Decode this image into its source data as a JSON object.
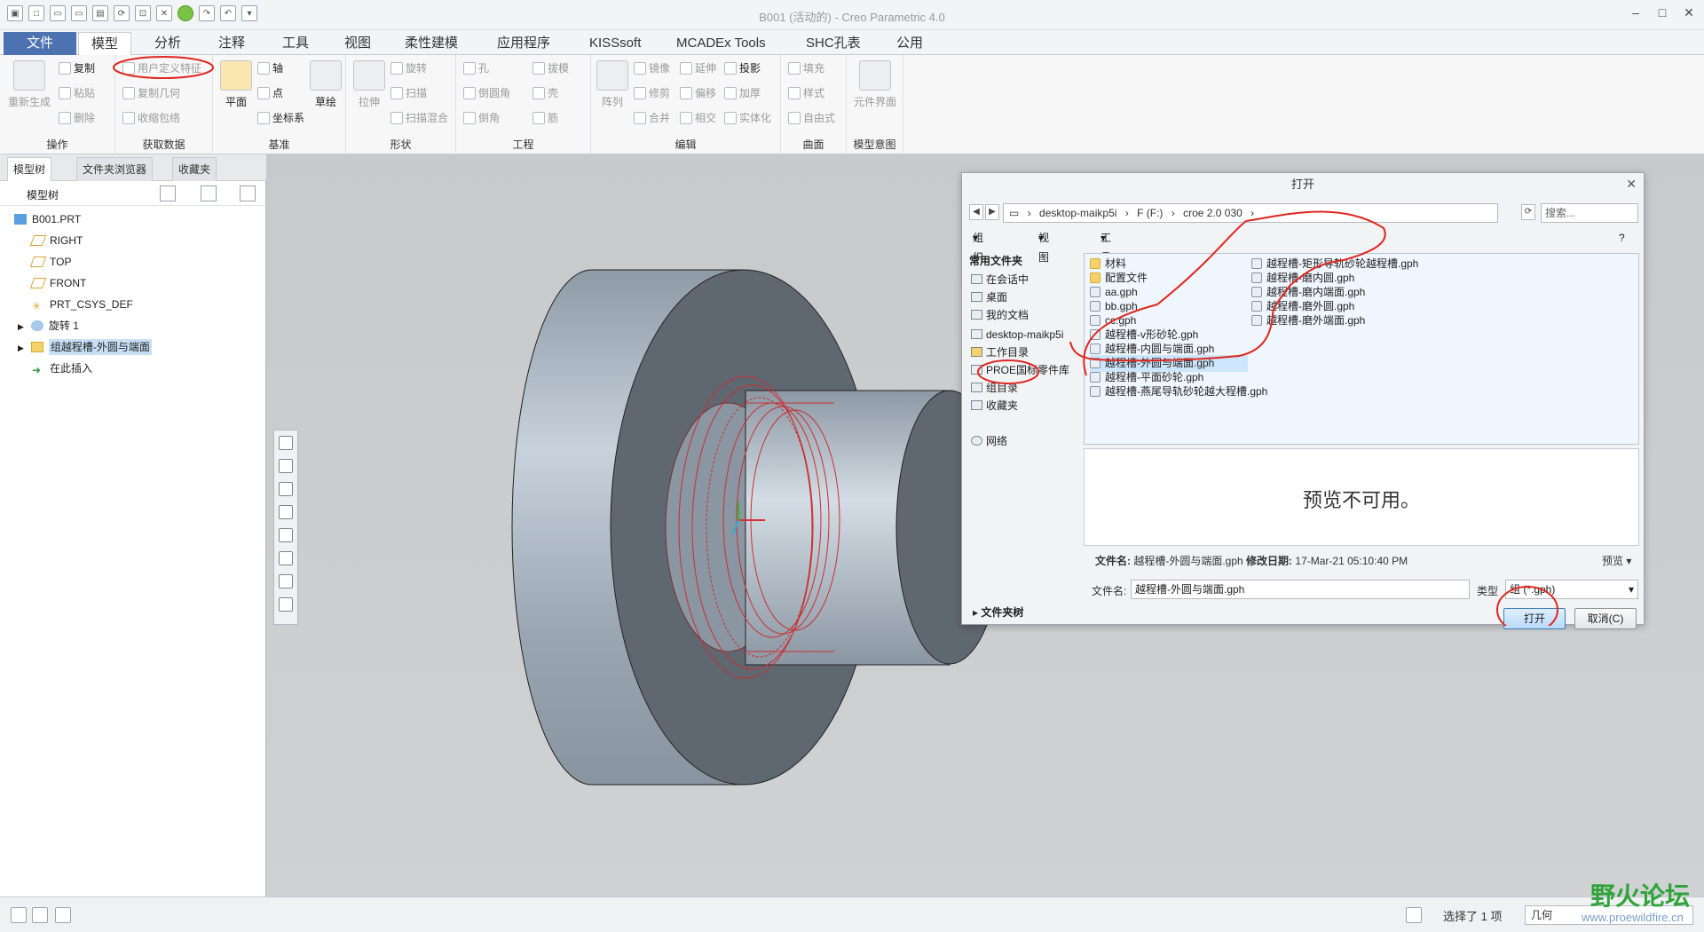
{
  "app": {
    "title": "B001 (活动的) - Creo Parametric 4.0"
  },
  "tabs": [
    "文件",
    "模型",
    "分析",
    "注释",
    "工具",
    "视图",
    "柔性建模",
    "应用程序",
    "KISSsoft",
    "MCADEx Tools",
    "SHC孔表",
    "公用"
  ],
  "active_tab": "模型",
  "ribbon": {
    "ops": {
      "label": "操作",
      "regen": "重新生成",
      "copy": "复制",
      "paste": "粘贴",
      "delete": "删除"
    },
    "getdata": {
      "label": "获取数据",
      "udf": "用户定义特征",
      "copygeom": "复制几何",
      "shrinkwrap": "收缩包络"
    },
    "datum": {
      "label": "基准",
      "plane": "平面",
      "axis": "轴",
      "point": "点",
      "csys": "坐标系",
      "sketch": "草绘"
    },
    "shape": {
      "label": "形状",
      "extrude": "拉伸",
      "revolve": "旋转",
      "sweep": "扫描",
      "sweptblend": "扫描混合"
    },
    "eng": {
      "label": "工程",
      "hole": "孔",
      "round": "倒圆角",
      "chamfer": "倒角",
      "draft": "拔模",
      "shell": "壳",
      "rib": "筋"
    },
    "edit": {
      "label": "编辑",
      "pattern": "阵列",
      "mirror": "镜像",
      "extend": "延伸",
      "project": "投影",
      "trim": "修剪",
      "offset": "偏移",
      "thicken": "加厚",
      "merge": "合并",
      "intersect": "相交",
      "solidify": "实体化"
    },
    "surfaces": {
      "label": "曲面",
      "fill": "填充",
      "style": "样式",
      "freestyle": "自由式"
    },
    "intent": {
      "label": "模型意图",
      "component_interface": "元件界面"
    }
  },
  "left_panel": {
    "tabs": [
      "模型树",
      "文件夹浏览器",
      "收藏夹"
    ],
    "tree_header": "模型树",
    "items": [
      {
        "label": "B001.PRT",
        "icon": "part-icon"
      },
      {
        "label": "RIGHT",
        "icon": "datum-plane-icon"
      },
      {
        "label": "TOP",
        "icon": "datum-plane-icon"
      },
      {
        "label": "FRONT",
        "icon": "datum-plane-icon"
      },
      {
        "label": "PRT_CSYS_DEF",
        "icon": "csys-icon"
      },
      {
        "label": "旋转 1",
        "icon": "revolve-icon"
      },
      {
        "label": "组越程槽-外圆与端面",
        "icon": "group-icon"
      },
      {
        "label": "在此插入",
        "icon": "insert-arrow-icon"
      }
    ]
  },
  "dialog": {
    "title": "打开",
    "address": [
      "desktop-maikp5i",
      "F (F:)",
      "croe 2.0 030"
    ],
    "search_placeholder": "搜索...",
    "toolbar": {
      "organize": "组织",
      "views": "视图",
      "tools": "工具"
    },
    "nav_header": "常用文件夹",
    "nav_items": [
      "在会话中",
      "桌面",
      "我的文档",
      "desktop-maikp5i",
      "工作目录",
      "PROE国标零件库",
      "组目录",
      "收藏夹",
      "网络"
    ],
    "files_col1": [
      {
        "name": "材料",
        "type": "folder"
      },
      {
        "name": "配置文件",
        "type": "folder"
      },
      {
        "name": "aa.gph",
        "type": "gph"
      },
      {
        "name": "bb.gph",
        "type": "gph"
      },
      {
        "name": "cc.gph",
        "type": "gph"
      },
      {
        "name": "越程槽-v形砂轮.gph",
        "type": "gph"
      },
      {
        "name": "越程槽-内圆与端面.gph",
        "type": "gph"
      },
      {
        "name": "越程槽-外圆与端面.gph",
        "type": "gph"
      },
      {
        "name": "越程槽-平面砂轮.gph",
        "type": "gph"
      },
      {
        "name": "越程槽-燕尾导轨砂轮越大程槽.gph",
        "type": "gph"
      }
    ],
    "files_col2": [
      {
        "name": "越程槽-矩形导轨砂轮越程槽.gph",
        "type": "gph"
      },
      {
        "name": "越程槽-磨内圆.gph",
        "type": "gph"
      },
      {
        "name": "越程槽-磨内端面.gph",
        "type": "gph"
      },
      {
        "name": "越程槽-磨外圆.gph",
        "type": "gph"
      },
      {
        "name": "越程槽-磨外端面.gph",
        "type": "gph"
      }
    ],
    "selected_file": "越程槽-外圆与端面.gph",
    "preview_text": "预览不可用。",
    "info": {
      "filename_label": "文件名:",
      "filename": "越程槽-外圆与端面.gph",
      "modified_label": "修改日期:",
      "modified": "17-Mar-21 05:10:40 PM",
      "preview_label": "预览"
    },
    "filename_field_label": "文件名:",
    "filename_value": "越程槽-外圆与端面.gph",
    "type_label": "类型",
    "type_value": "组 (*.gph)",
    "open_button": "打开",
    "cancel_button": "取消(C)",
    "folder_tree": "文件夹树"
  },
  "statusbar": {
    "status": "选择了 1 项",
    "filter": "几何"
  },
  "watermark": {
    "name": "野火论坛",
    "url": "www.proewildfire.cn"
  },
  "colors": {
    "file_tab": "#4c72b0",
    "selection": "#cde6fb",
    "annotation_red": "#e0261f",
    "watermark_green": "#2ea43a"
  }
}
